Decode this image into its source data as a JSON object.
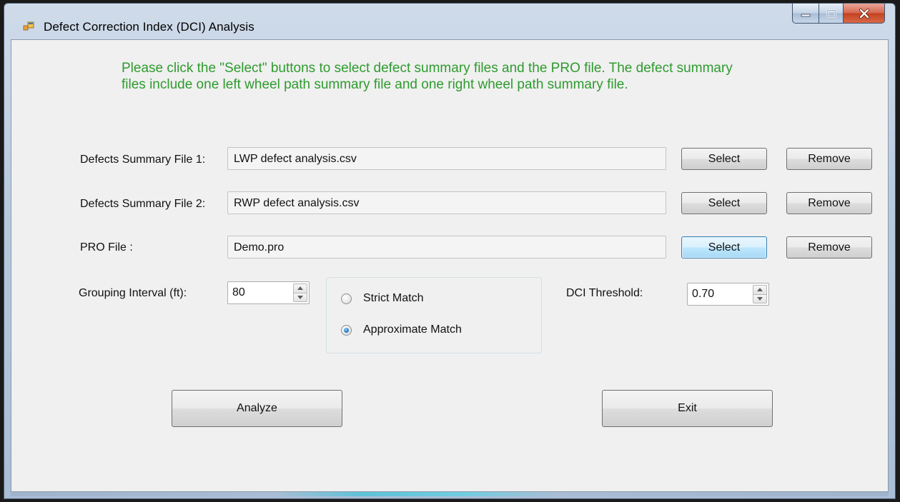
{
  "window": {
    "title": "Defect Correction Index (DCI) Analysis"
  },
  "instructions": "Please click the \"Select\" buttons to select defect summary files and the PRO file. The defect summary files include one left wheel path summary file and one right wheel path summary file.",
  "files": [
    {
      "label": "Defects Summary File 1:",
      "value": "LWP defect analysis.csv",
      "select_label": "Select",
      "remove_label": "Remove"
    },
    {
      "label": "Defects Summary File 2:",
      "value": "RWP defect analysis.csv",
      "select_label": "Select",
      "remove_label": "Remove"
    },
    {
      "label": "PRO File :",
      "value": "Demo.pro",
      "select_label": "Select",
      "remove_label": "Remove"
    }
  ],
  "grouping": {
    "label": "Grouping Interval (ft):",
    "value": "80"
  },
  "match": {
    "options": [
      {
        "label": "Strict Match",
        "checked": false
      },
      {
        "label": "Approximate Match",
        "checked": true
      }
    ]
  },
  "threshold": {
    "label": "DCI Threshold:",
    "value": "0.70"
  },
  "actions": {
    "analyze_label": "Analyze",
    "exit_label": "Exit"
  },
  "colors": {
    "instruction_text": "#2e9b2e",
    "client_background": "#f0f0f0",
    "close_button": "#c4401f"
  },
  "icons": [
    "app-icon",
    "minimize-icon",
    "maximize-icon",
    "close-icon",
    "spin-up-icon",
    "spin-down-icon"
  ]
}
